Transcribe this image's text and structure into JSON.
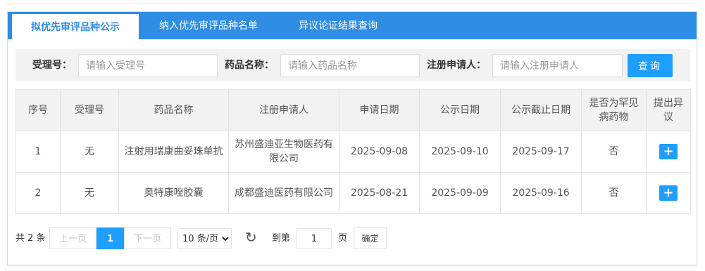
{
  "tabs": [
    {
      "label": "拟优先审评品种公示",
      "active": true
    },
    {
      "label": "纳入优先审评品种名单",
      "active": false
    },
    {
      "label": "异议论证结果查询",
      "active": false
    }
  ],
  "search": {
    "acceptance_label": "受理号：",
    "acceptance_placeholder": "请输入受理号",
    "drug_label": "药品名称：",
    "drug_placeholder": "请输入药品名称",
    "applicant_label": "注册申请人：",
    "applicant_placeholder": "请输入注册申请人",
    "query_label": "查询"
  },
  "table": {
    "headers": [
      "序号",
      "受理号",
      "药品名称",
      "注册申请人",
      "申请日期",
      "公示日期",
      "公示截止日期",
      "是否为罕见病药物",
      "提出异议"
    ],
    "rows": [
      {
        "no": "1",
        "acceptance_no": "无",
        "drug_name": "注射用瑞康曲妥珠单抗",
        "applicant": "苏州盛迪亚生物医药有限公司",
        "apply_date": "2025-09-08",
        "publish_date": "2025-09-10",
        "deadline": "2025-09-17",
        "rare_disease": "否",
        "objection": "+"
      },
      {
        "no": "2",
        "acceptance_no": "无",
        "drug_name": "奥特康唑胶囊",
        "applicant": "成都盛迪医药有限公司",
        "apply_date": "2025-08-21",
        "publish_date": "2025-09-09",
        "deadline": "2025-09-16",
        "rare_disease": "否",
        "objection": "+"
      }
    ]
  },
  "pagination": {
    "total": "共 2 条",
    "prev": "上一页",
    "current": "1",
    "next": "下一页",
    "page_size": "10 条/页",
    "refresh_icon": "↻",
    "goto_label": "到第",
    "goto_value": "1",
    "page_unit": "页",
    "confirm": "确定"
  },
  "colors": {
    "tab_bar": "#2f8de4",
    "primary_button": "#1e9fff",
    "search_bg": "#f2f2f2"
  }
}
